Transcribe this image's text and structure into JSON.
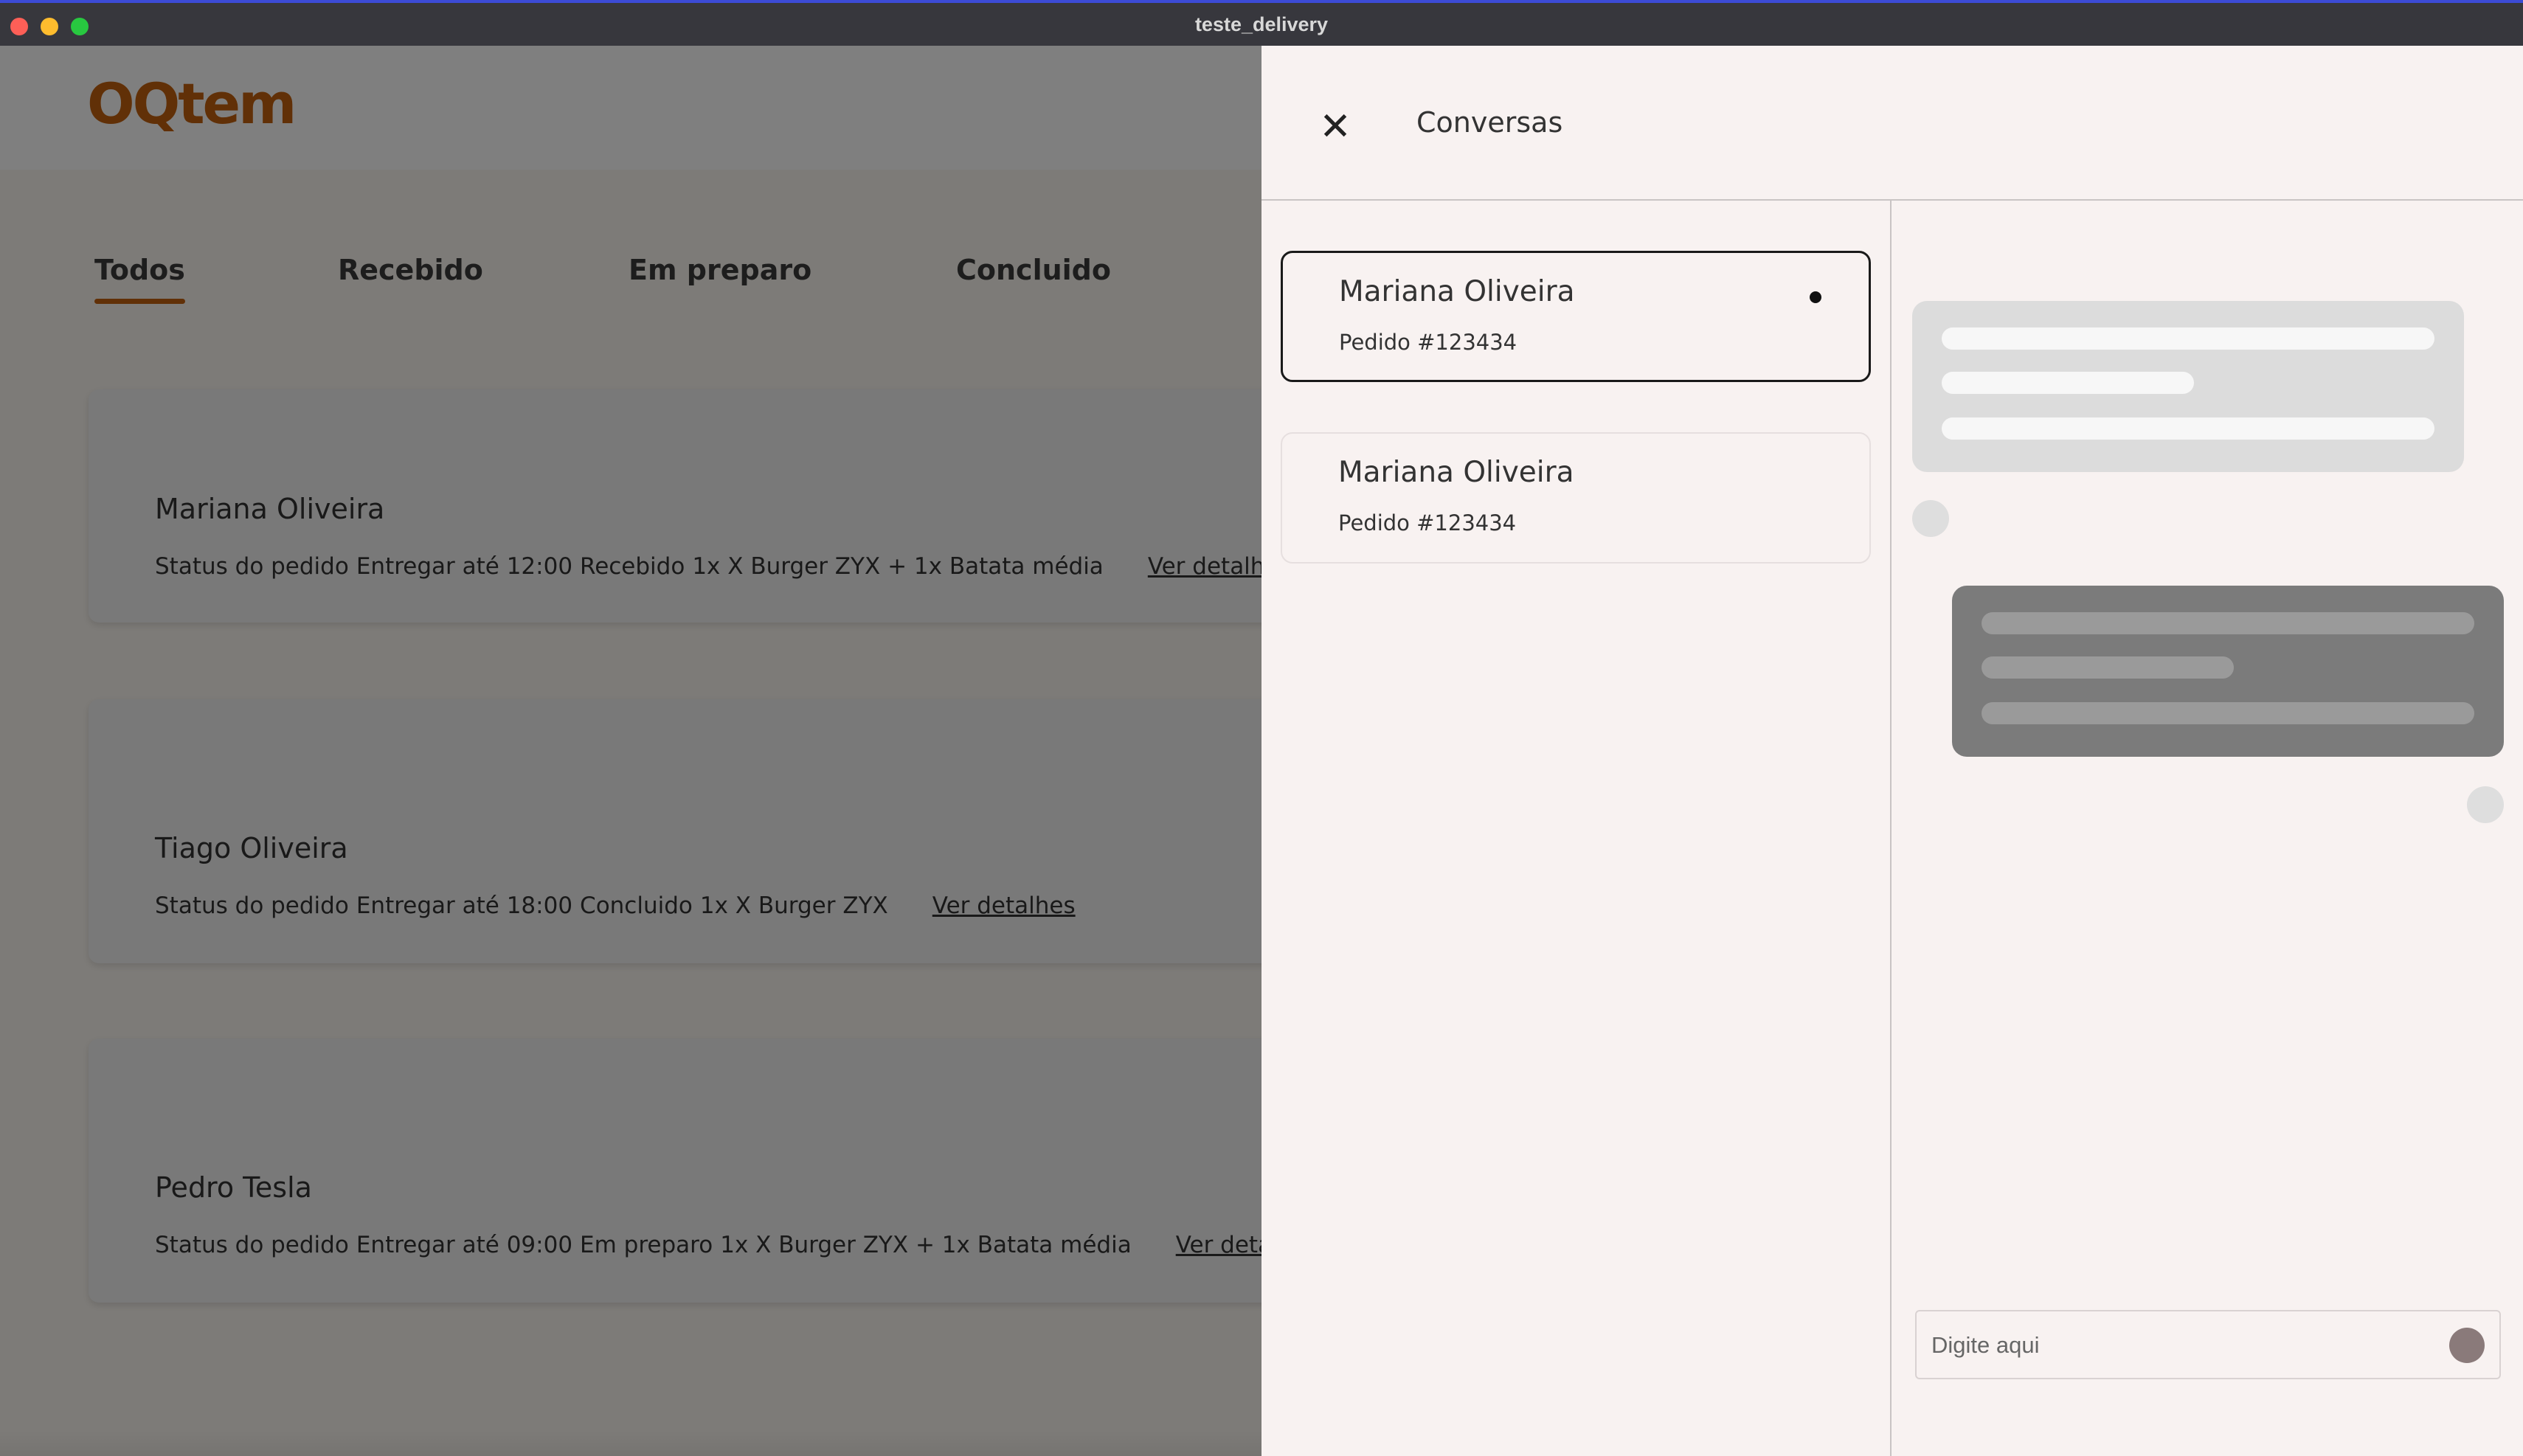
{
  "window": {
    "title": "teste_delivery"
  },
  "header": {
    "logo_text": "OQtem"
  },
  "tabs": [
    {
      "label": "Todos",
      "active": true
    },
    {
      "label": "Recebido",
      "active": false
    },
    {
      "label": "Em preparo",
      "active": false
    },
    {
      "label": "Concluido",
      "active": false
    }
  ],
  "orders": [
    {
      "name": "Mariana Oliveira",
      "status_label": "Status do pedido",
      "deadline": "Entregar até 12:00",
      "status": "Recebido",
      "items": "1x X Burger ZYX + 1x Batata média",
      "link": "Ver detalhes"
    },
    {
      "name": "Tiago Oliveira",
      "status_label": "Status do pedido",
      "deadline": "Entregar até 18:00",
      "status": "Concluido",
      "items": "1x X Burger ZYX",
      "link": "Ver detalhes"
    },
    {
      "name": "Pedro Tesla",
      "status_label": "Status do pedido",
      "deadline": "Entregar até 09:00",
      "status": "Em preparo",
      "items": "1x X Burger ZYX + 1x Batata média",
      "link": "Ver detalhes"
    }
  ],
  "chat_panel": {
    "title": "Conversas",
    "conversations": [
      {
        "name": "Mariana Oliveira",
        "order": "Pedido #123434",
        "unread": true,
        "selected": true
      },
      {
        "name": "Mariana Oliveira",
        "order": "Pedido #123434",
        "unread": false,
        "selected": false
      }
    ],
    "input_placeholder": "Digite aqui"
  },
  "colors": {
    "brand": "#c2610e",
    "panel_bg": "#f8f2f1",
    "bubble_incoming": "#dcdcdc",
    "bubble_outgoing": "#7b7b7b"
  }
}
